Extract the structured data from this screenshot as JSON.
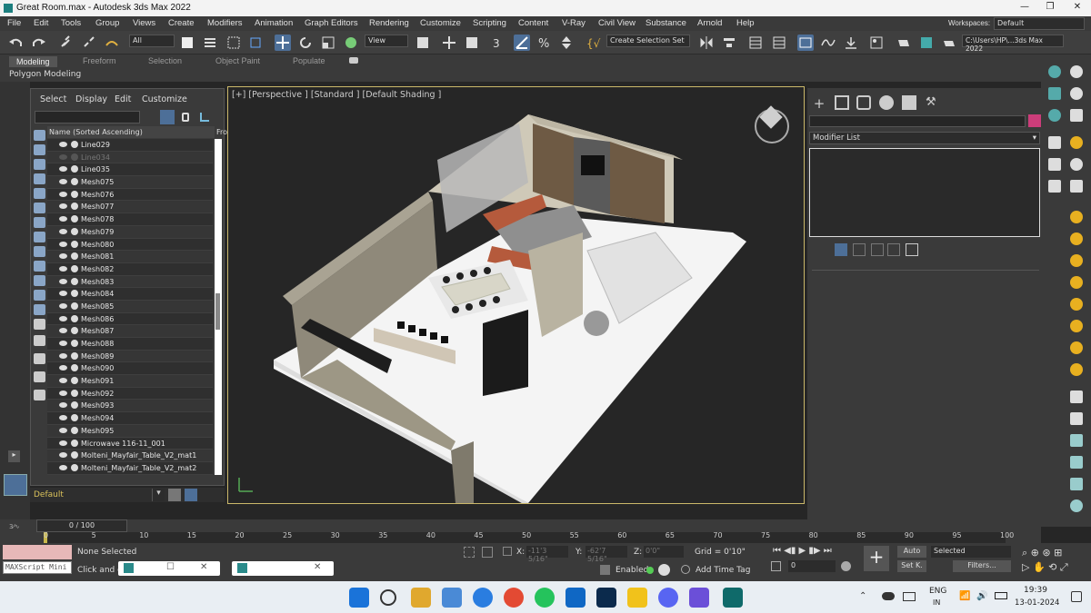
{
  "window": {
    "title": "Great Room.max - Autodesk 3ds Max 2022",
    "min": "—",
    "max": "❐",
    "close": "✕"
  },
  "menu": [
    "File",
    "Edit",
    "Tools",
    "Group",
    "Views",
    "Create",
    "Modifiers",
    "Animation",
    "Graph Editors",
    "Rendering",
    "Customize",
    "Scripting",
    "Content",
    "V-Ray",
    "Civil View",
    "Substance",
    "Arnold",
    "Help"
  ],
  "workspaces": {
    "label": "Workspaces:",
    "value": "Default"
  },
  "toolbar": {
    "selection_filter": "All",
    "ref_coord": "View",
    "selection_set": "Create Selection Set",
    "path": "C:\\Users\\HP\\...3ds Max 2022"
  },
  "ribbon": {
    "tabs": [
      "Modeling",
      "Freeform",
      "Selection",
      "Object Paint",
      "Populate"
    ],
    "active": "Modeling",
    "panel": "Polygon Modeling"
  },
  "scene_explorer": {
    "menus": [
      "Select",
      "Display",
      "Edit",
      "Customize"
    ],
    "column": "Name (Sorted Ascending)",
    "column2": "Fro",
    "items": [
      "Line029",
      "Line034",
      "Line035",
      "Mesh075",
      "Mesh076",
      "Mesh077",
      "Mesh078",
      "Mesh079",
      "Mesh080",
      "Mesh081",
      "Mesh082",
      "Mesh083",
      "Mesh084",
      "Mesh085",
      "Mesh086",
      "Mesh087",
      "Mesh088",
      "Mesh089",
      "Mesh090",
      "Mesh091",
      "Mesh092",
      "Mesh093",
      "Mesh094",
      "Mesh095",
      "Microwave 116-11_001",
      "Molteni_Mayfair_Table_V2_mat1",
      "Molteni_Mayfair_Table_V2_mat2"
    ],
    "dim_item": "Line034",
    "layer": "Default"
  },
  "viewport": {
    "label": "[+] [Perspective ] [Standard ] [Default Shading ]",
    "floor_text": "OPEN TO BELOW"
  },
  "command_panel": {
    "modifier_list": "Modifier List"
  },
  "timeline": {
    "frame": "0 / 100",
    "ticks": [
      "0",
      "5",
      "10",
      "15",
      "20",
      "25",
      "30",
      "35",
      "40",
      "45",
      "50",
      "55",
      "60",
      "65",
      "70",
      "75",
      "80",
      "85",
      "90",
      "95",
      "100"
    ]
  },
  "status": {
    "script": "MAXScript Mini",
    "selection": "None Selected",
    "prompt": "Click and dr",
    "x_label": "X:",
    "x": "-11'3 5/16\"",
    "y_label": "Y:",
    "y": "-62'7 5/16\"",
    "z_label": "Z:",
    "z": "0'0\"",
    "grid": "Grid = 0'10\"",
    "enabled": "Enabled:",
    "add_tag": "Add Time Tag",
    "auto": "Auto",
    "set_key": "Set K.",
    "key_mode": "Selected",
    "filters": "Filters...",
    "frame_field": "0"
  },
  "tray": {
    "lang": "ENG",
    "region": "IN",
    "time": "19:39",
    "date": "13-01-2024"
  },
  "colors": {
    "accent": "#4d6f98",
    "viewport_border": "#cbb86a",
    "color_swatch": "#cc3d7a",
    "sofa": "#b55a3c"
  }
}
